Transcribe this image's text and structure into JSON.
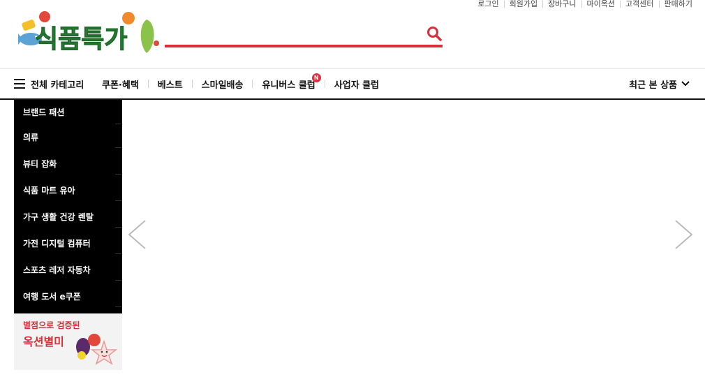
{
  "utility_links": [
    "로그인",
    "회원가입",
    "장바구니",
    "마이옥션",
    "고객센터",
    "판매하기"
  ],
  "logo_text": "식품특가",
  "search": {
    "value": "",
    "placeholder": ""
  },
  "gnb": {
    "all_categories": "전체 카테고리",
    "menu": [
      "쿠폰·혜택",
      "베스트",
      "스마일배송",
      "유니버스 클럽",
      "사업자 클럽"
    ],
    "new_badge": "N",
    "recent": "최근 본 상품"
  },
  "categories": [
    "브랜드 패션",
    "의류",
    "뷰티 잡화",
    "식품 마트 유아",
    "가구 생활 건강 렌탈",
    "가전 디지털 컴퓨터",
    "스포츠 레저 자동차",
    "여행 도서 e쿠폰"
  ],
  "banner": {
    "line1": "별점으로 검증된",
    "line2": "옥션별미"
  },
  "colors": {
    "accent": "#d8303a",
    "logo_green": "#2f8a3c"
  }
}
